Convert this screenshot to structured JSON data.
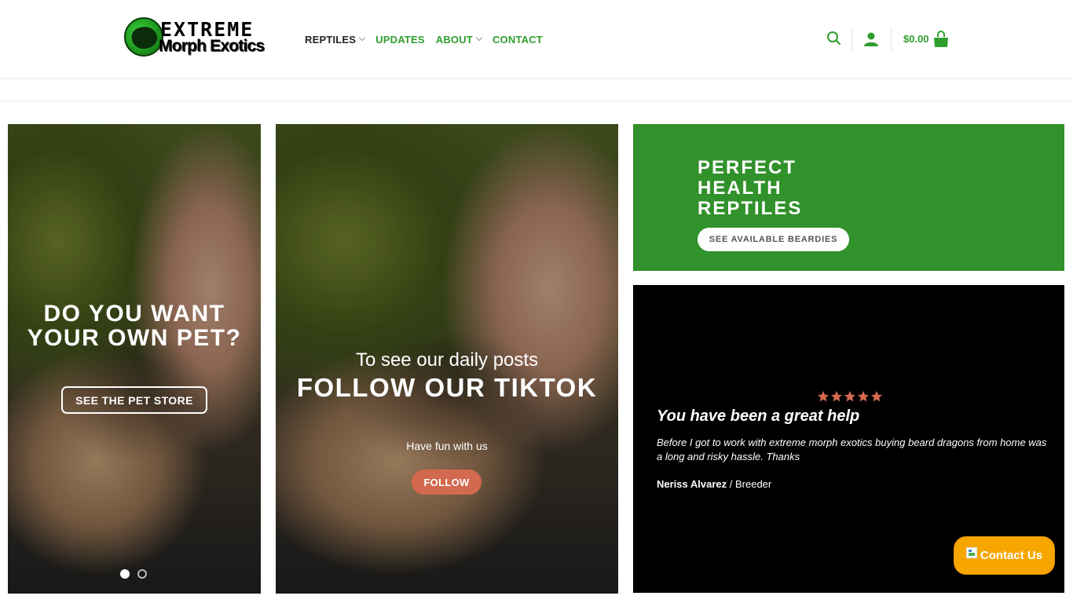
{
  "header": {
    "logo": {
      "line1": "EXTREME",
      "line2": "Morph Exotics"
    },
    "nav": [
      {
        "label": "REPTILES",
        "has_dropdown": true
      },
      {
        "label": "UPDATES",
        "has_dropdown": false
      },
      {
        "label": "ABOUT",
        "has_dropdown": true
      },
      {
        "label": "CONTACT",
        "has_dropdown": false
      }
    ],
    "cart_amount": "$0.00",
    "icons": [
      "search-icon",
      "user-icon",
      "cart-bag-icon"
    ]
  },
  "slider": {
    "title": "DO YOU WANT YOUR OWN PET?",
    "button": "SEE THE PET STORE",
    "slides": 2,
    "active_slide": 1
  },
  "tiktok": {
    "subtitle": "To see our daily posts",
    "title": "FOLLOW OUR TIKTOK",
    "tagline": "Have fun with us",
    "button": "FOLLOW"
  },
  "promo": {
    "title": "PERFECT HEALTH REPTILES",
    "button": "SEE AVAILABLE BEARDIES"
  },
  "review": {
    "rating": 5,
    "title": "You have been a great help",
    "body": "Before I got to work with extreme morph exotics buying beard dragons from home was a long and risky hassle. Thanks",
    "author": "Neriss Alvarez",
    "role": "/ Breeder"
  },
  "contact_widget": {
    "label": "Contact Us"
  },
  "colors": {
    "brand_green": "#31912b",
    "nav_green": "#2f9e2f",
    "follow_button": "#d3694e",
    "star": "#d3694e",
    "contact_button": "#f7a600",
    "review_bg": "#000000"
  }
}
